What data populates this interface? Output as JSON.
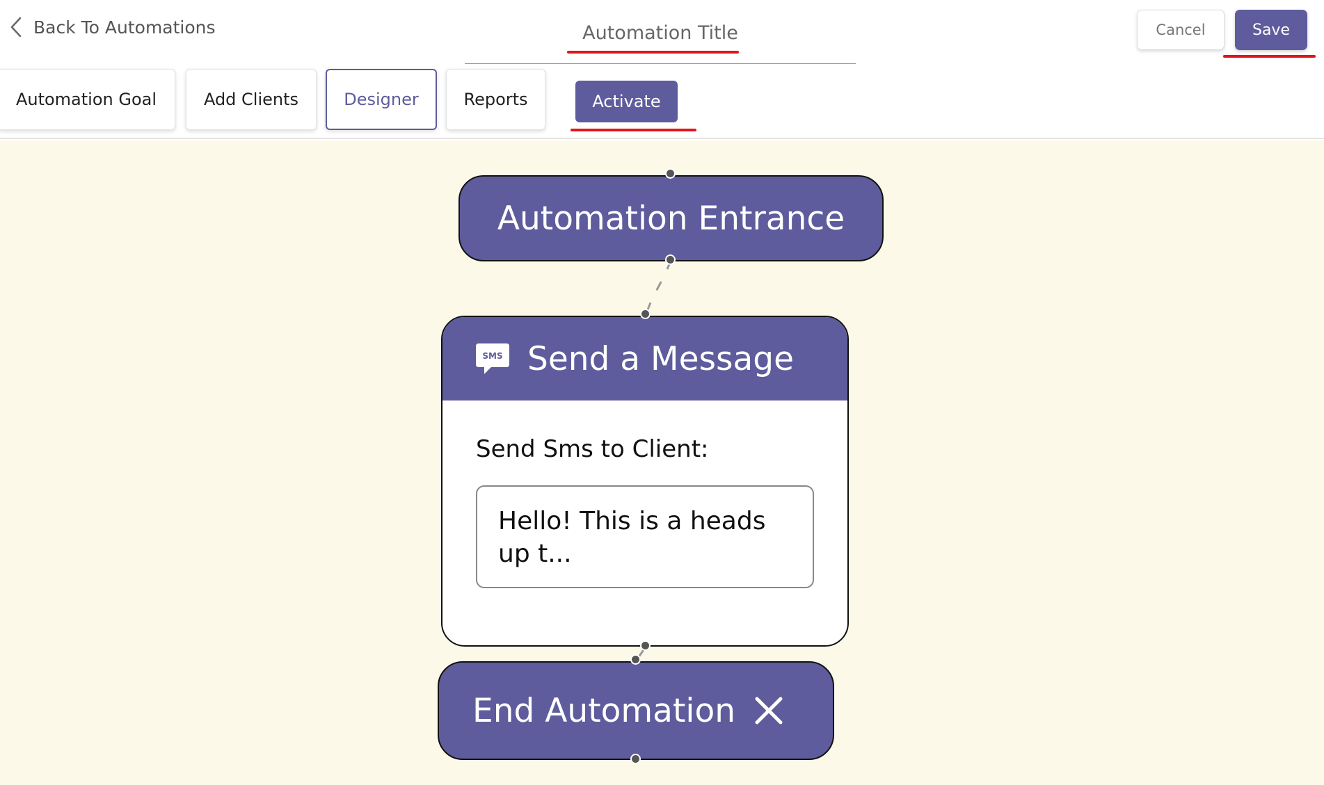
{
  "header": {
    "back_label": "Back To Automations",
    "title_placeholder": "Automation Title",
    "cancel_label": "Cancel",
    "save_label": "Save",
    "tabs": [
      {
        "label": "Automation Goal",
        "active": false
      },
      {
        "label": "Add Clients",
        "active": false
      },
      {
        "label": "Designer",
        "active": true
      },
      {
        "label": "Reports",
        "active": false
      }
    ],
    "activate_label": "Activate"
  },
  "canvas": {
    "entrance_label": "Automation Entrance",
    "message_node": {
      "icon": "sms-icon",
      "icon_text": "SMS",
      "title": "Send a Message",
      "field_label": "Send Sms to Client:",
      "preview": "Hello! This is a heads up t..."
    },
    "end_label": "End Automation"
  },
  "colors": {
    "accent": "#5e5c9c",
    "canvas_bg": "#fdf9e9",
    "highlight": "#e0151a"
  }
}
